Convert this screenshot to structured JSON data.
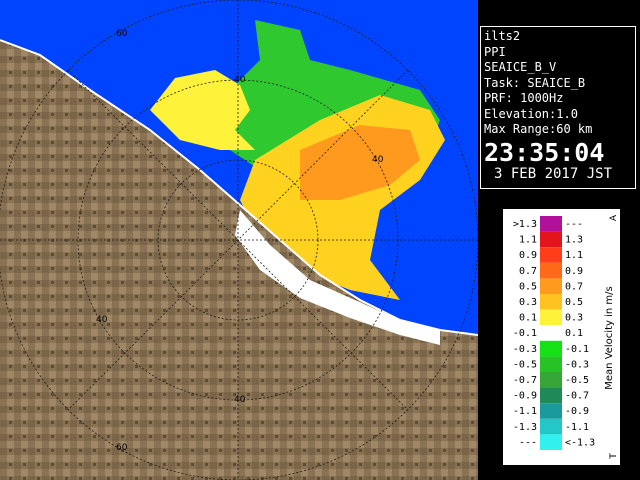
{
  "info": {
    "site": "ilts2",
    "mode": "PPI",
    "product": "SEAICE_B_V",
    "task": "Task: SEAICE_B",
    "prf": "PRF: 1000Hz",
    "elevation": "Elevation:1.0",
    "max_range": "Max Range:60 km",
    "time": "23:35:04",
    "date": "3 FEB 2017 JST"
  },
  "map": {
    "range_ring_labels": [
      "60",
      "40",
      "40",
      "40",
      "40",
      "60"
    ],
    "colors": {
      "sea": "#0044ff",
      "land": "#8a7355",
      "no_echo_land": "#ffffff",
      "coast": "#ffffff",
      "rings": "#1a1a1a"
    }
  },
  "legend": {
    "title": "Mean Velocity in m/s",
    "top_marker": "A",
    "bottom_marker": "T",
    "rows": [
      {
        "left": ">1.3",
        "right": "---",
        "color": "#b0109a"
      },
      {
        "left": "1.1",
        "right": "1.3",
        "color": "#e3141b"
      },
      {
        "left": "0.9",
        "right": "1.1",
        "color": "#ff3d1a"
      },
      {
        "left": "0.7",
        "right": "0.9",
        "color": "#ff6a1a"
      },
      {
        "left": "0.5",
        "right": "0.7",
        "color": "#ff9a1f"
      },
      {
        "left": "0.3",
        "right": "0.5",
        "color": "#ffc21f"
      },
      {
        "left": "0.1",
        "right": "0.3",
        "color": "#fff23a"
      },
      {
        "left": "-0.1",
        "right": "0.1",
        "color": "#ffffff"
      },
      {
        "left": "-0.3",
        "right": "-0.1",
        "color": "#16e016"
      },
      {
        "left": "-0.5",
        "right": "-0.3",
        "color": "#26c226"
      },
      {
        "left": "-0.7",
        "right": "-0.5",
        "color": "#37a637"
      },
      {
        "left": "-0.9",
        "right": "-0.7",
        "color": "#1f8a55"
      },
      {
        "left": "-1.1",
        "right": "-0.9",
        "color": "#1a9a9a"
      },
      {
        "left": "-1.3",
        "right": "-1.1",
        "color": "#22c8c8"
      },
      {
        "left": "---",
        "right": "<-1.3",
        "color": "#33f0f0"
      }
    ]
  }
}
